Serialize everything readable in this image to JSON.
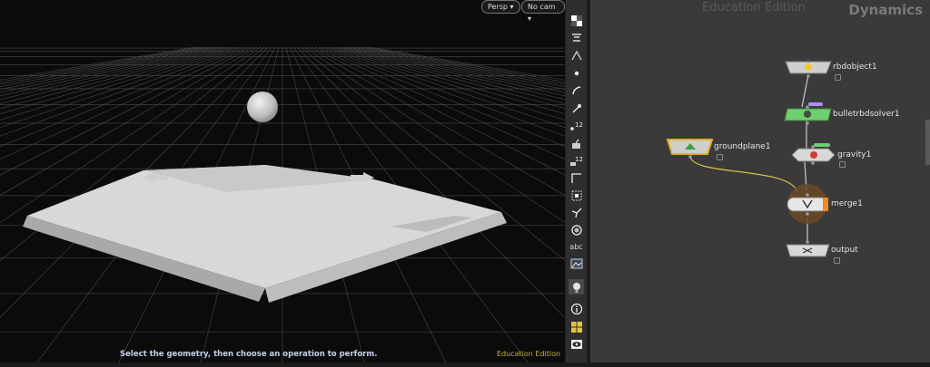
{
  "viewport": {
    "camera_mode": "Persp",
    "camera_view": "No cam",
    "status_message": "Select the geometry, then choose an operation to perform.",
    "edition_label": "Education Edition"
  },
  "shelf": {
    "tool_labels": {
      "display_12a": "12",
      "display_12b": "12",
      "text_tool": "abc"
    }
  },
  "network": {
    "watermark": "Education Edition",
    "context": "Dynamics",
    "nodes": {
      "rbdobject": "rbdobject1",
      "solver": "bulletrbdsolver1",
      "groundplane": "groundplane1",
      "gravity": "gravity1",
      "merge": "merge1",
      "output": "output"
    }
  },
  "colors": {
    "solver_green": "#6fd06f",
    "ground_yellow": "#e0b020",
    "merge_orange": "#f08a1c",
    "wire": "#c9c9c9"
  }
}
